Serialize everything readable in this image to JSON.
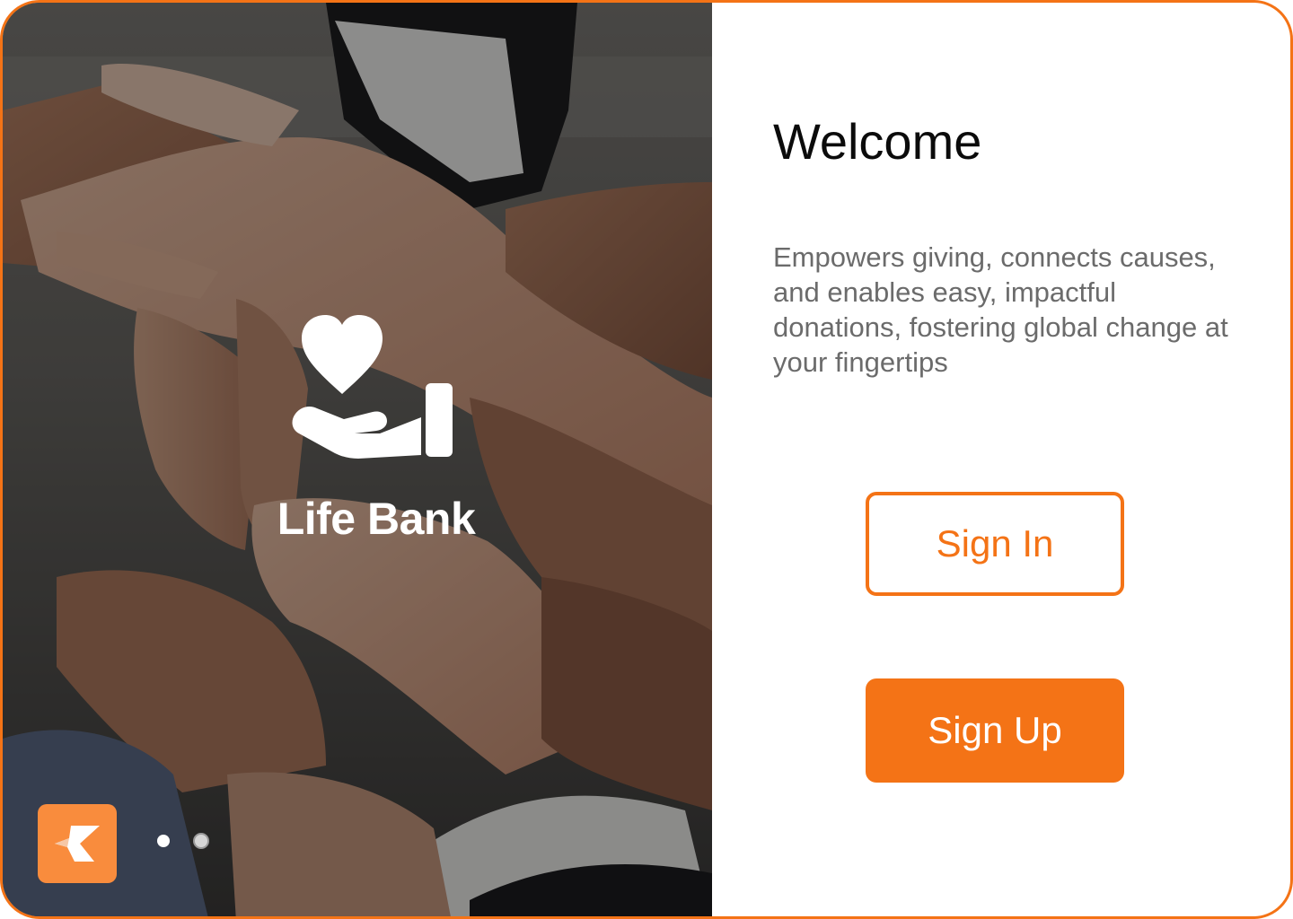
{
  "brand": {
    "name": "Life Bank",
    "icon": "heart-in-hand-icon",
    "badge_icon": "app-logo-icon"
  },
  "carousel": {
    "total_slides": 2,
    "active_slide": 1
  },
  "welcome": {
    "title": "Welcome",
    "description": "Empowers giving, connects causes, and enables easy, impactful donations, fostering global change at your fingertips"
  },
  "actions": {
    "sign_in_label": "Sign In",
    "sign_up_label": "Sign Up"
  },
  "colors": {
    "accent": "#f47316",
    "badge": "#f98c3d",
    "description_text": "#6b6b6b"
  }
}
